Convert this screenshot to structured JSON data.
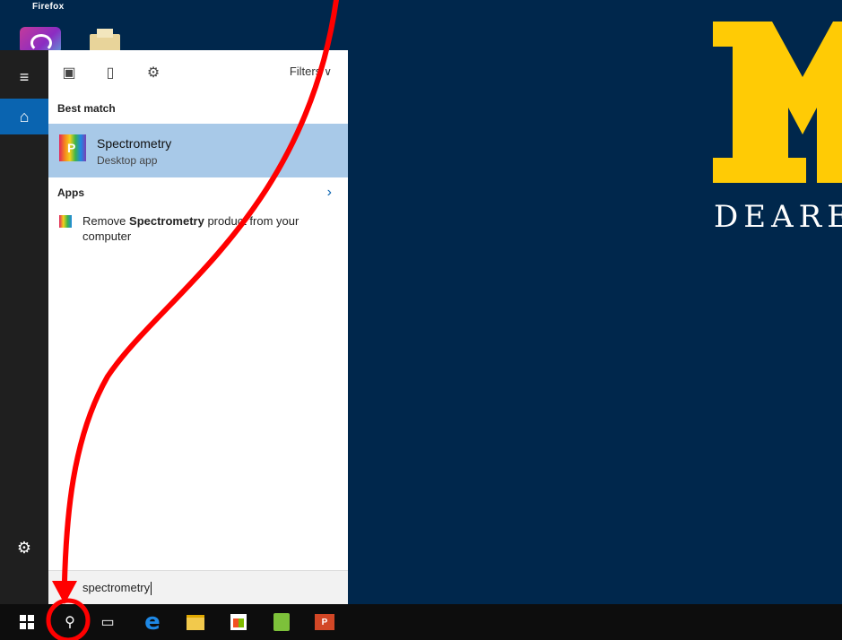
{
  "desktop": {
    "label": "Firefox",
    "logo_text": "DEAREB",
    "colors": {
      "background": "#00274c",
      "maize": "#ffcb05"
    }
  },
  "start_menu": {
    "rail": {
      "hamburger_icon": "hamburger-icon",
      "home_icon": "home-icon",
      "settings_icon": "gear-icon"
    },
    "top_bar": {
      "filters_label": "Filters",
      "icons": [
        "grid-icon",
        "document-icon",
        "gear-icon"
      ]
    },
    "best_match": {
      "section_label": "Best match",
      "title": "Spectrometry",
      "subtitle": "Desktop app",
      "icon_letter": "P"
    },
    "apps": {
      "section_label": "Apps",
      "items": [
        {
          "prefix": "Remove ",
          "bold": "Spectrometry",
          "suffix": " product from your computer"
        }
      ]
    },
    "search": {
      "value": "spectrometry"
    }
  },
  "taskbar": {
    "items": [
      "windows-start-icon",
      "search-icon",
      "task-view-icon",
      "edge-icon",
      "file-explorer-icon",
      "store-icon",
      "green-app-icon",
      "powerpoint-icon"
    ],
    "ppt_label": "P"
  },
  "annotation": {
    "color": "#ff0000"
  }
}
